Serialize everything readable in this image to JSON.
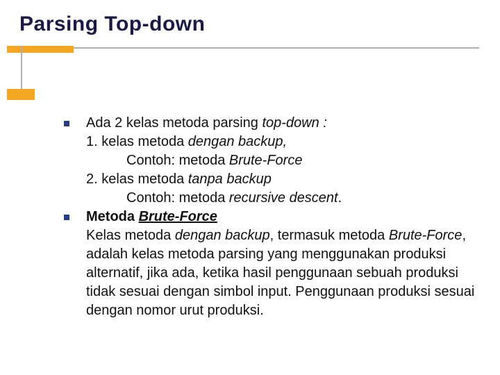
{
  "title": "Parsing Top-down",
  "content": {
    "item1": {
      "line1_a": "Ada 2 kelas metoda parsing ",
      "line1_b": "top-down :",
      "line2_a": "1. kelas metoda ",
      "line2_b": "dengan backup,",
      "line3_a": "Contoh: metoda ",
      "line3_b": "Brute-Force",
      "line4_a": "2. kelas metoda ",
      "line4_b": "tanpa backup",
      "line5_a": "Contoh: metoda ",
      "line5_b": "recursive descent",
      "line5_c": "."
    },
    "item2": {
      "heading_a": "Metoda ",
      "heading_b": "Brute-Force",
      "para_a": "Kelas metoda ",
      "para_b": "dengan backup",
      "para_c": ", termasuk metoda ",
      "para_d": "Brute-Force",
      "para_e": ", adalah kelas metoda parsing yang menggunakan produksi alternatif, jika ada, ketika hasil penggunaan sebuah produksi tidak sesuai dengan simbol input. Penggunaan produksi sesuai dengan nomor urut produksi."
    }
  }
}
